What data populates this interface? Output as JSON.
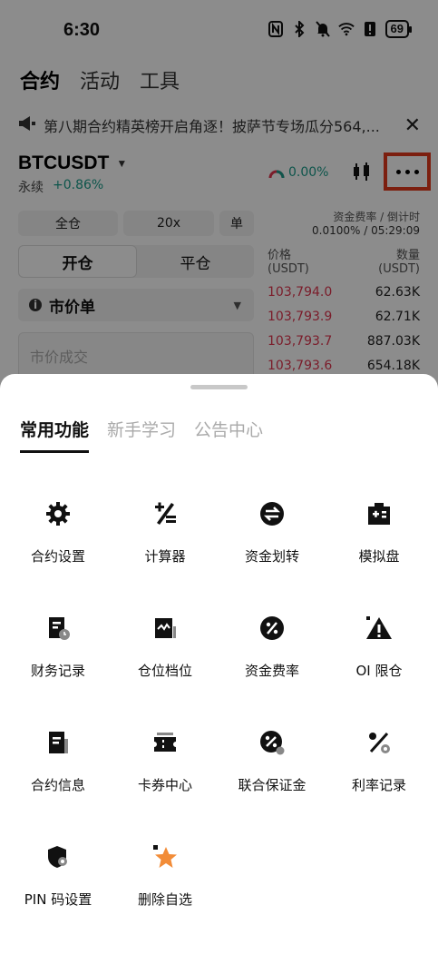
{
  "status_bar": {
    "time": "6:30",
    "battery": "69"
  },
  "top_tabs": [
    "合约",
    "活动",
    "工具"
  ],
  "announcement": {
    "text": "第八期合约精英榜开启角逐！披萨节专场瓜分564,...",
    "close": "✕"
  },
  "symbol": {
    "name": "BTCUSDT",
    "type": "永续",
    "change": "+0.86%",
    "gauge_value": "0.00%"
  },
  "controls": {
    "margin_mode": "全仓",
    "leverage": "20x",
    "side_mode": "单",
    "open_label": "开仓",
    "close_label": "平仓",
    "order_type": "市价单",
    "market_placeholder": "市价成交"
  },
  "order_book": {
    "funding_label": "资金费率 / 倒计时",
    "funding_value": "0.0100% / 05:29:09",
    "price_header": "价格",
    "price_unit": "(USDT)",
    "qty_header": "数量",
    "qty_unit": "(USDT)",
    "rows": [
      {
        "price": "103,794.0",
        "qty": "62.63K"
      },
      {
        "price": "103,793.9",
        "qty": "62.71K"
      },
      {
        "price": "103,793.7",
        "qty": "887.03K"
      },
      {
        "price": "103,793.6",
        "qty": "654.18K"
      }
    ]
  },
  "sheet": {
    "tabs": [
      "常用功能",
      "新手学习",
      "公告中心"
    ],
    "items": [
      {
        "label": "合约设置",
        "icon": "gear-icon"
      },
      {
        "label": "计算器",
        "icon": "calculator-icon"
      },
      {
        "label": "资金划转",
        "icon": "transfer-icon"
      },
      {
        "label": "模拟盘",
        "icon": "demo-trading-icon"
      },
      {
        "label": "财务记录",
        "icon": "finance-record-icon"
      },
      {
        "label": "仓位档位",
        "icon": "position-tier-icon"
      },
      {
        "label": "资金费率",
        "icon": "funding-rate-icon"
      },
      {
        "label": "OI 限仓",
        "icon": "warning-icon"
      },
      {
        "label": "合约信息",
        "icon": "contract-info-icon"
      },
      {
        "label": "卡券中心",
        "icon": "coupon-icon"
      },
      {
        "label": "联合保证金",
        "icon": "joint-margin-icon"
      },
      {
        "label": "利率记录",
        "icon": "interest-rate-icon"
      },
      {
        "label": "PIN 码设置",
        "icon": "pin-shield-icon"
      },
      {
        "label": "删除自选",
        "icon": "star-icon"
      }
    ]
  },
  "colors": {
    "accent_green": "#1a9c8a",
    "ask_red": "#e0364f",
    "highlight": "#e23a1c",
    "star": "#f28c38"
  }
}
